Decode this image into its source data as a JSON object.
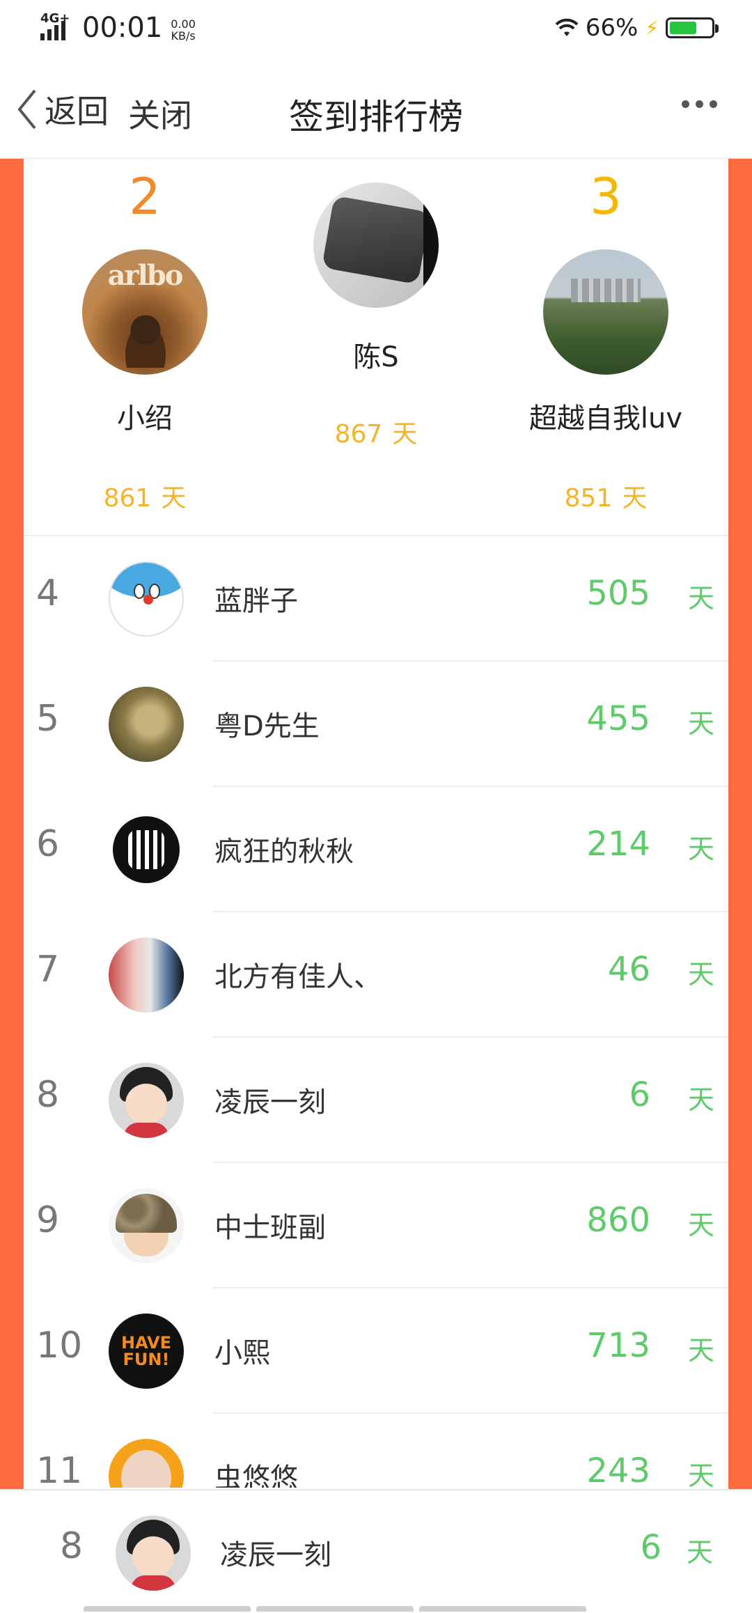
{
  "status": {
    "network": "4G+",
    "time": "00:01",
    "speed_value": "0.00",
    "speed_unit": "KB/s",
    "battery": "66%",
    "battery_level": 0.66
  },
  "nav": {
    "back_label": "返回",
    "close_label": "关闭",
    "title": "签到排行榜"
  },
  "podium": {
    "second": {
      "rank": "2",
      "name": "小绍",
      "days": "861",
      "unit": "天",
      "avatar_text": "arlbo"
    },
    "first": {
      "name": "陈S",
      "days": "867",
      "unit": "天"
    },
    "third": {
      "rank": "3",
      "name": "超越自我luv",
      "days": "851",
      "unit": "天"
    }
  },
  "list": [
    {
      "rank": "4",
      "name": "蓝胖子",
      "days": "505",
      "unit": "天",
      "avatar": "doraemon-avatar"
    },
    {
      "rank": "5",
      "name": "粤D先生",
      "days": "455",
      "unit": "天",
      "avatar": "toy-avatar"
    },
    {
      "rank": "6",
      "name": "疯狂的秋秋",
      "days": "214",
      "unit": "天",
      "avatar": "emblem-avatar"
    },
    {
      "rank": "7",
      "name": "北方有佳人、",
      "days": "46",
      "unit": "天",
      "avatar": "collage-avatar"
    },
    {
      "rank": "8",
      "name": "凌辰一刻",
      "days": "6",
      "unit": "天",
      "avatar": "cartoon-boy-avatar"
    },
    {
      "rank": "9",
      "name": "中士班副",
      "days": "860",
      "unit": "天",
      "avatar": "soldier-avatar"
    },
    {
      "rank": "10",
      "name": "小熙",
      "days": "713",
      "unit": "天",
      "avatar": "have-fun-avatar",
      "avatar_text_1": "HAVE",
      "avatar_text_2": "FUN!"
    },
    {
      "rank": "11",
      "name": "虫悠悠",
      "days": "243",
      "unit": "天",
      "avatar": "cartoon-old-man-avatar"
    }
  ],
  "me": {
    "rank": "8",
    "name": "凌辰一刻",
    "days": "6",
    "unit": "天"
  },
  "colors": {
    "accent_frame": "#ff6b3d",
    "podium_days": "#f5b32a",
    "rank2": "#f08a2a",
    "rank3": "#f5b800",
    "days_green": "#5ecb6b"
  }
}
